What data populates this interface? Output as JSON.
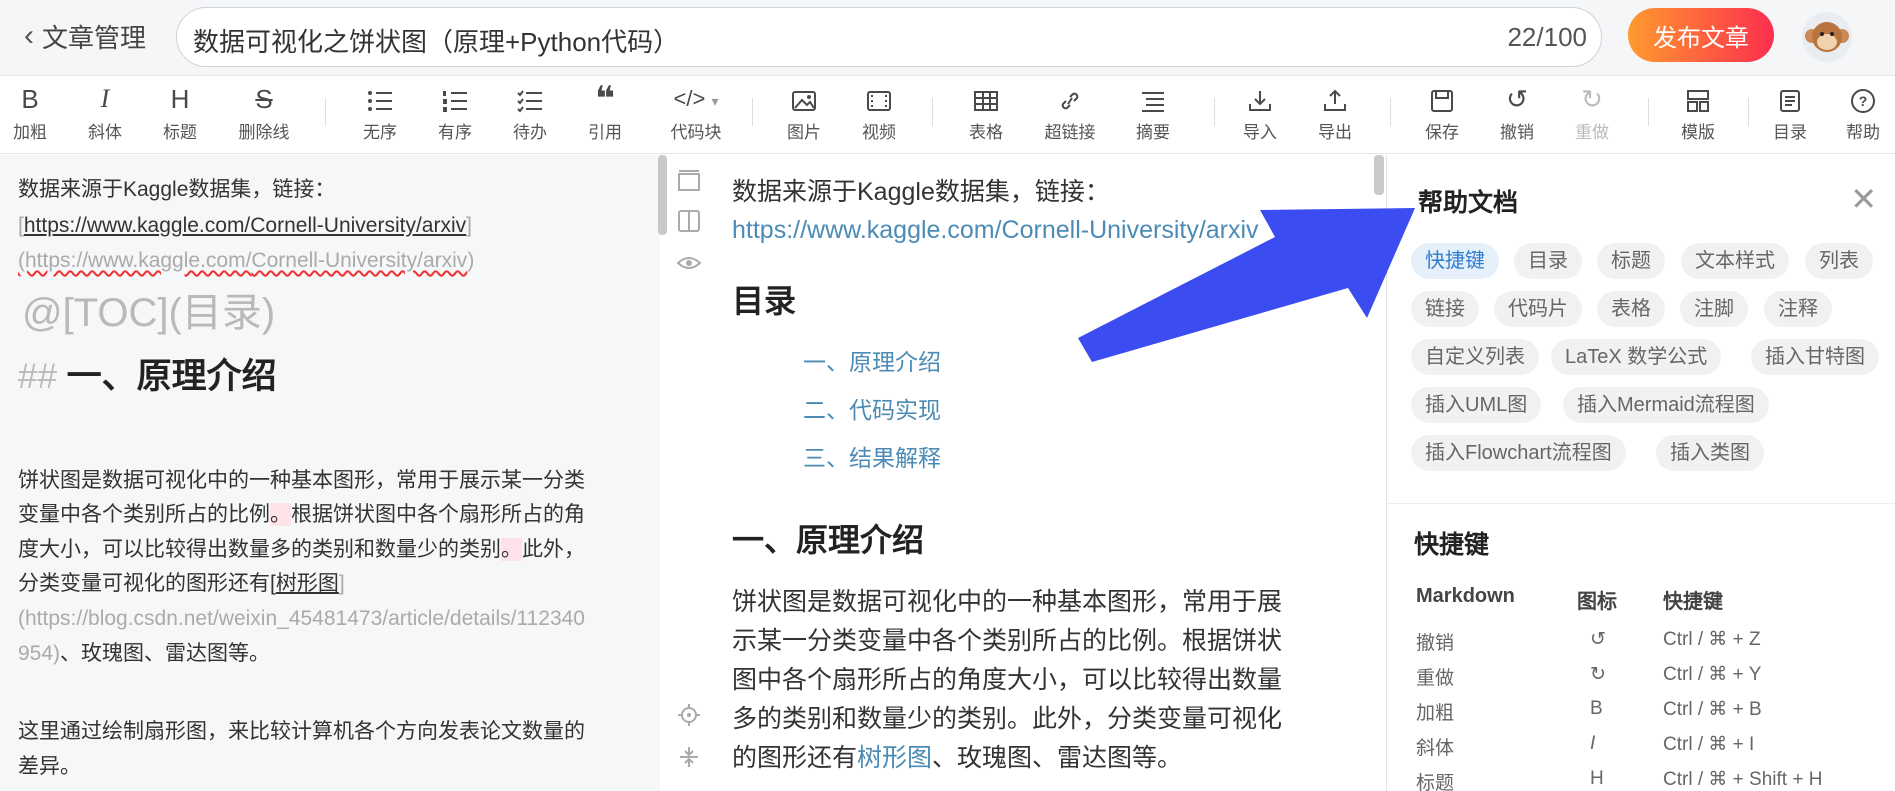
{
  "header": {
    "back_label": "文章管理",
    "title": "数据可视化之饼状图（原理+Python代码）",
    "count": "22/100",
    "publish_label": "发布文章"
  },
  "toolbar": {
    "items": [
      {
        "icon": "bold-icon",
        "glyph": "B",
        "label": "加粗"
      },
      {
        "icon": "italic-icon",
        "glyph": "I",
        "label": "斜体"
      },
      {
        "icon": "heading-icon",
        "glyph": "H",
        "label": "标题"
      },
      {
        "icon": "strikethrough-icon",
        "glyph": "S",
        "label": "删除线"
      },
      {
        "icon": "unordered-list-icon",
        "glyph": "☰",
        "label": "无序"
      },
      {
        "icon": "ordered-list-icon",
        "glyph": "☰",
        "label": "有序"
      },
      {
        "icon": "todo-list-icon",
        "glyph": "☰",
        "label": "待办"
      },
      {
        "icon": "quote-icon",
        "glyph": "❝",
        "label": "引用"
      },
      {
        "icon": "code-block-icon",
        "glyph": "</>",
        "label": "代码块"
      },
      {
        "icon": "image-icon",
        "glyph": "▣",
        "label": "图片"
      },
      {
        "icon": "video-icon",
        "glyph": "▤",
        "label": "视频"
      },
      {
        "icon": "table-icon",
        "glyph": "▦",
        "label": "表格"
      },
      {
        "icon": "link-icon",
        "glyph": "⛓",
        "label": "超链接"
      },
      {
        "icon": "summary-icon",
        "glyph": "≣",
        "label": "摘要"
      },
      {
        "icon": "import-icon",
        "glyph": "⤓",
        "label": "导入"
      },
      {
        "icon": "export-icon",
        "glyph": "⤒",
        "label": "导出"
      },
      {
        "icon": "save-icon",
        "glyph": "▭",
        "label": "保存"
      },
      {
        "icon": "undo-icon",
        "glyph": "↺",
        "label": "撤销"
      },
      {
        "icon": "redo-icon",
        "glyph": "↻",
        "label": "重做"
      },
      {
        "icon": "template-icon",
        "glyph": "▥",
        "label": "模版"
      },
      {
        "icon": "toc-icon",
        "glyph": "▤",
        "label": "目录"
      },
      {
        "icon": "help-icon",
        "glyph": "?",
        "label": "帮助"
      }
    ]
  },
  "editor": {
    "line1": "数据来源于Kaggle数据集，链接：",
    "line2_a": "[",
    "line2_b": "https://www.kaggle.com/Cornell-University/arxiv",
    "line2_c": "]",
    "line3_a": "(https://www.kaggle.com/",
    "line3_b": "Cornell-University/arxiv",
    "line3_c": ")",
    "toc": "@[TOC](目录)",
    "h2_hash": "##",
    "h2_text": "一、原理介绍",
    "p1": "饼状图是数据可视化中的一种基本图形，常用于展示某一分类",
    "p2a": "变量中各个类别所占的比例",
    "p2b": "。",
    "p2c": "根据饼状图中各个扇形所占的角",
    "p3a": "度大小，可以比较得出数量多的类别和数量少的类别",
    "p3b": "。",
    "p3c": "此外，",
    "p4a": "分类变量可视化的图形还有[",
    "p4b": "树形图",
    "p4c": "]",
    "p5": "(https://blog.csdn.net/weixin_45481473/article/details/112340",
    "p6a": "954)",
    "p6b": "、玫瑰图、雷达图等。",
    "p7": "这里通过绘制扇形图，来比较计算机各个方向发表论文数量的",
    "p8": "差异。"
  },
  "preview": {
    "line1": "数据来源于Kaggle数据集，链接：",
    "link": "https://www.kaggle.com/Cornell-University/arxiv",
    "toc_heading": "目录",
    "toc_items": [
      "一、原理介绍",
      "二、代码实现",
      "三、结果解释"
    ],
    "h1": "一、原理介绍",
    "p1": "饼状图是数据可视化中的一种基本图形，常用于展",
    "p2": "示某一分类变量中各个类别所占的比例。根据饼状",
    "p3": "图中各个扇形所占的角度大小，可以比较得出数量",
    "p4": "多的类别和数量少的类别。此外，分类变量可视化",
    "p5a": "的图形还有",
    "p5link": "树形图",
    "p5b": "、玫瑰图、雷达图等。"
  },
  "help": {
    "title": "帮助文档",
    "chips": [
      "快捷键",
      "目录",
      "标题",
      "文本样式",
      "列表",
      "链接",
      "代码片",
      "表格",
      "注脚",
      "注释",
      "自定义列表",
      "LaTeX 数学公式",
      "插入甘特图",
      "插入UML图",
      "插入Mermaid流程图",
      "插入Flowchart流程图",
      "插入类图"
    ],
    "section_title": "快捷键",
    "col_headers": [
      "Markdown",
      "图标",
      "快捷键"
    ],
    "rows": [
      {
        "name": "撤销",
        "icon": "↺",
        "keys": "Ctrl / ⌘ + Z"
      },
      {
        "name": "重做",
        "icon": "↻",
        "keys": "Ctrl / ⌘ + Y"
      },
      {
        "name": "加粗",
        "icon": "B",
        "keys": "Ctrl / ⌘ + B"
      },
      {
        "name": "斜体",
        "icon": "I",
        "keys": "Ctrl / ⌘ + I"
      },
      {
        "name": "标题",
        "icon": "H",
        "keys": "Ctrl / ⌘ + Shift + H"
      }
    ]
  },
  "colors": {
    "publish_gradient_start": "#ff9a2e",
    "publish_gradient_end": "#fc2e4e",
    "link": "#4c8bb5",
    "active_chip": "#2f7dd1",
    "arrow": "#3b4cf0"
  }
}
